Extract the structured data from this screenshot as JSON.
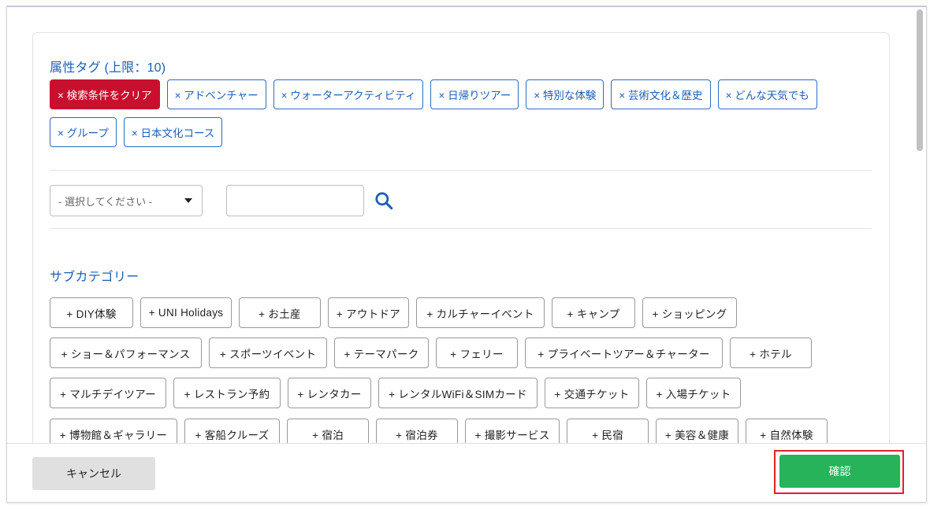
{
  "attributes": {
    "title": "属性タグ (上限：10)",
    "clear_label": "× 検索条件をクリア",
    "selected_tags_row1": [
      "× アドベンチャー",
      "× ウォーターアクティビティ",
      "× 日帰りツアー",
      "× 特別な体験",
      "× 芸術文化＆歴史",
      "× どんな天気でも"
    ],
    "selected_tags_row2": [
      "× グループ",
      "× 日本文化コース"
    ]
  },
  "filter": {
    "select_value": "- 選択してください -",
    "search_value": ""
  },
  "subcategory": {
    "title": "サブカテゴリー",
    "rows": [
      [
        "+ DIY体験",
        "+ UNI Holidays",
        "+ お土産",
        "+ アウトドア",
        "+ カルチャーイベント",
        "+ キャンプ",
        "+ ショッピング"
      ],
      [
        "+ ショー＆パフォーマンス",
        "+ スポーツイベント",
        "+ テーマパーク",
        "+ フェリー",
        "+ プライベートツアー＆チャーター",
        "+ ホテル"
      ],
      [
        "+ マルチデイツアー",
        "+ レストラン予約",
        "+ レンタカー",
        "+ レンタルWiFi＆SIMカード",
        "+ 交通チケット",
        "+ 入場チケット"
      ],
      [
        "+ 博物館＆ギャラリー",
        "+ 客船クルーズ",
        "+ 宿泊",
        "+ 宿泊券",
        "+ 撮影サービス",
        "+ 民宿",
        "+ 美容＆健康",
        "+ 自然体験"
      ]
    ]
  },
  "footer": {
    "cancel_label": "キャンセル",
    "confirm_label": "確認"
  },
  "colors": {
    "clear_tag_bg": "#c8102e",
    "tag_accent": "#2b6cc4",
    "confirm_bg": "#26b35a",
    "highlight_border": "#e3202a"
  }
}
